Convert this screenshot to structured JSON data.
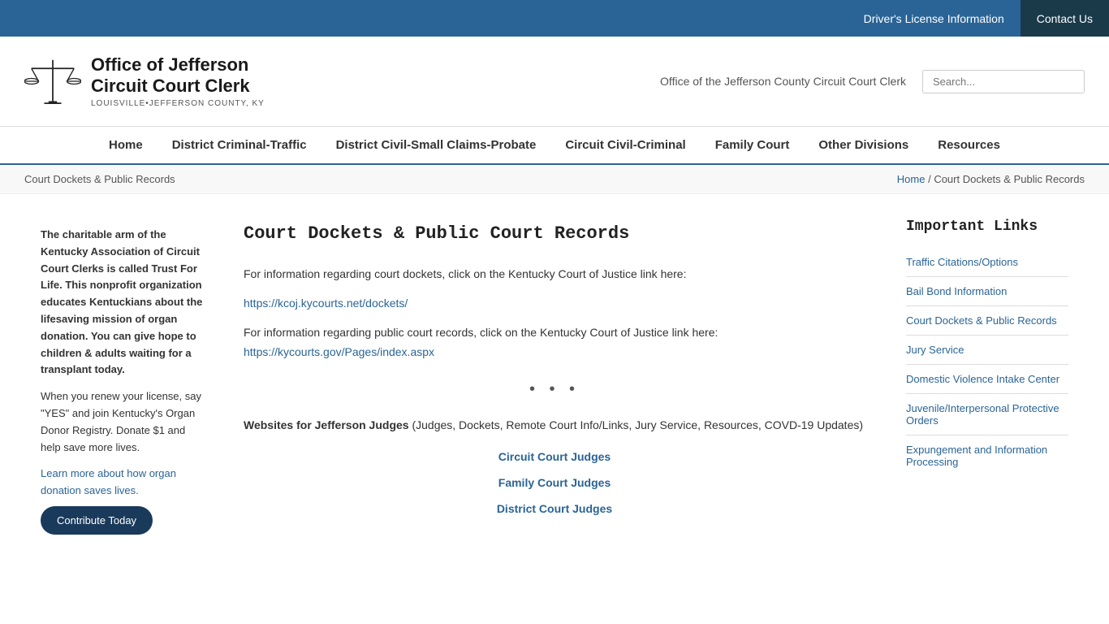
{
  "topbar": {
    "drivers_license": "Driver's License Information",
    "contact_us": "Contact Us"
  },
  "header": {
    "logo_line1": "Office of Jefferson",
    "logo_line2": "Circuit Court Clerk",
    "logo_subtitle": "Louisville•Jefferson County, KY",
    "site_name": "Office of the Jefferson County Circuit Court Clerk",
    "search_placeholder": "Search..."
  },
  "nav": {
    "items": [
      "Home",
      "District Criminal-Traffic",
      "District Civil-Small Claims-Probate",
      "Circuit Civil-Criminal",
      "Family Court",
      "Other Divisions",
      "Resources"
    ]
  },
  "breadcrumb": {
    "left": "Court Dockets & Public Records",
    "home": "Home",
    "separator": "/",
    "current": "Court Dockets & Public Records"
  },
  "left_sidebar": {
    "bold_paragraph": "The charitable arm of the Kentucky Association of Circuit Court Clerks is called Trust For Life. This nonprofit organization educates Kentuckians about the lifesaving mission of organ donation. You can give hope to children & adults waiting for a transplant today.",
    "normal_paragraph": "When you renew your license, say \"YES\" and join Kentucky's Organ Donor Registry. Donate $1 and help save more lives.",
    "link_text": "Learn more about how organ donation saves lives.",
    "button_label": "Contribute Today"
  },
  "main": {
    "page_title": "Court Dockets & Public Court Records",
    "para1": "For information regarding court dockets, click on the Kentucky Court of Justice link here:",
    "link1": "https://kcoj.kycourts.net/dockets/",
    "para2_prefix": "For information regarding public court records, click on the Kentucky Court of Justice link here:",
    "link2": "https://kycourts.gov/Pages/index.aspx",
    "dots": "• • •",
    "judges_intro_bold": "Websites for Jefferson Judges",
    "judges_intro_rest": " (Judges, Dockets, Remote Court Info/Links, Jury Service, Resources, COVD-19 Updates)",
    "judge_links": [
      "Circuit Court Judges",
      "Family Court Judges",
      "District Court Judges"
    ]
  },
  "right_sidebar": {
    "title": "Important Links",
    "links": [
      "Traffic Citations/Options",
      "Bail Bond Information",
      "Court Dockets & Public Records",
      "Jury Service",
      "Domestic Violence Intake Center",
      "Juvenile/Interpersonal Protective Orders",
      "Expungement and Information Processing"
    ]
  }
}
